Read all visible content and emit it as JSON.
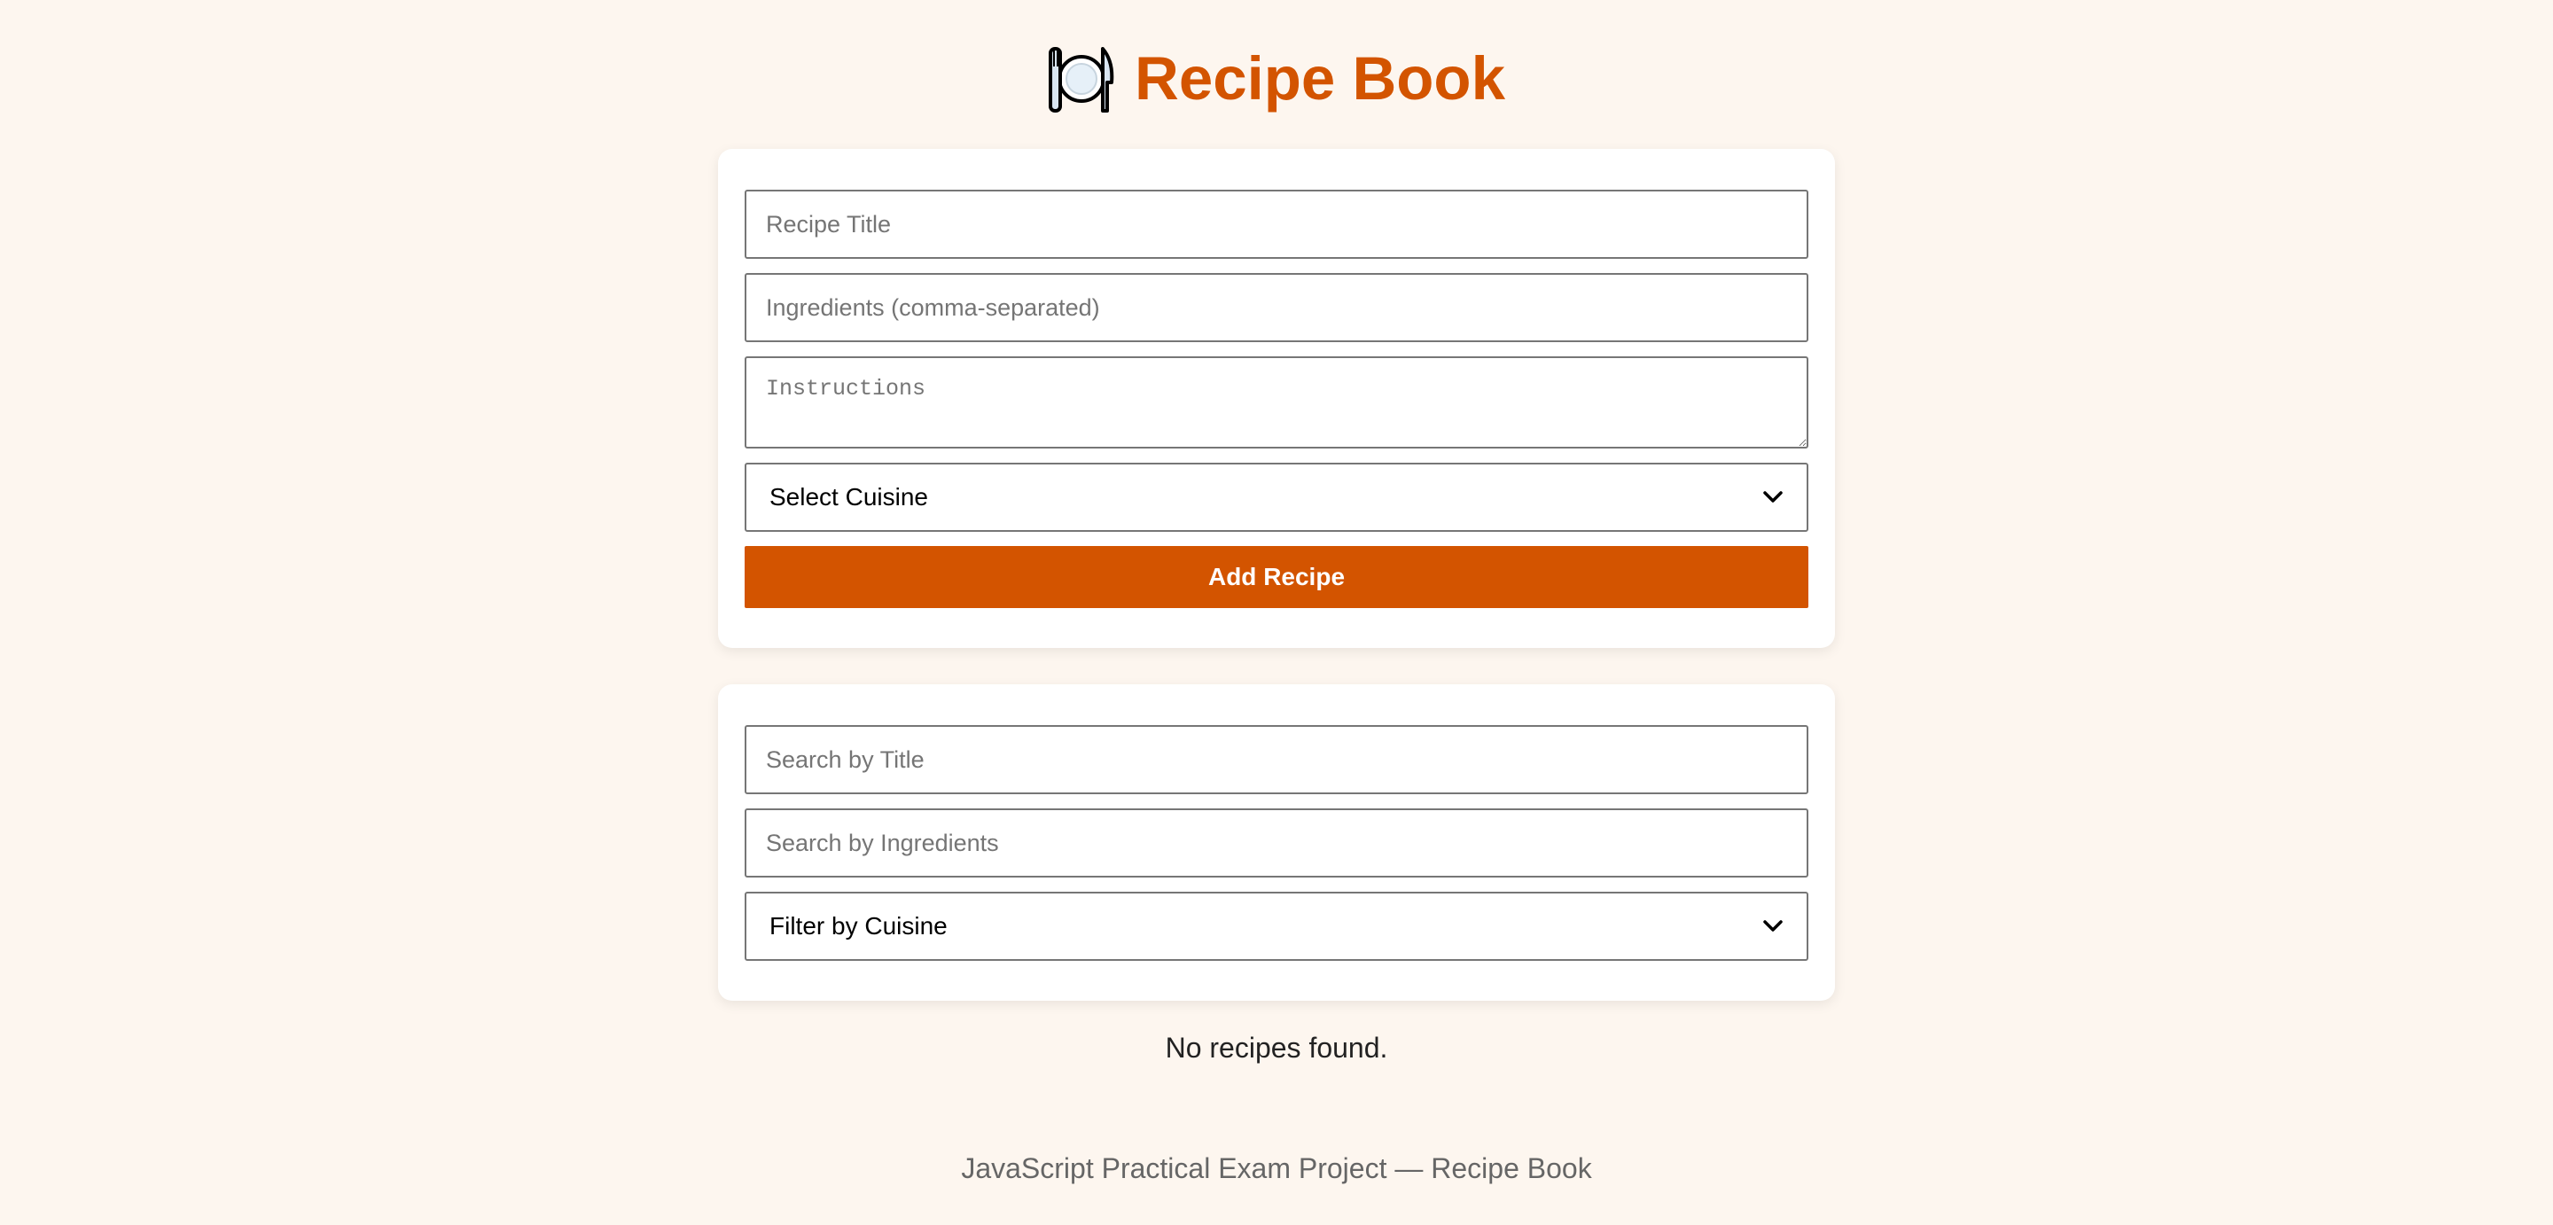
{
  "header": {
    "icon": "plate-fork-knife-icon",
    "title": "Recipe Book"
  },
  "add_form": {
    "title_placeholder": "Recipe Title",
    "ingredients_placeholder": "Ingredients (comma-separated)",
    "instructions_placeholder": "Instructions",
    "cuisine_select_value": "Select Cuisine",
    "add_button_label": "Add Recipe"
  },
  "search_form": {
    "title_placeholder": "Search by Title",
    "ingredients_placeholder": "Search by Ingredients",
    "cuisine_filter_value": "Filter by Cuisine"
  },
  "results": {
    "empty_message": "No recipes found."
  },
  "footer": {
    "text": "JavaScript Practical Exam Project — Recipe Book"
  },
  "colors": {
    "accent": "#d35400",
    "background": "#fdf6ef",
    "card": "#ffffff"
  }
}
